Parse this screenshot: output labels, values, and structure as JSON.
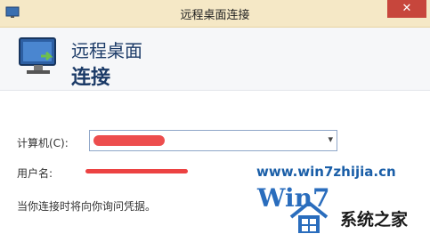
{
  "window": {
    "title": "远程桌面连接",
    "close_label": "✕"
  },
  "header": {
    "line1": "远程桌面",
    "line2": "连接"
  },
  "form": {
    "computer_label": "计算机(C):",
    "computer_value": "",
    "user_label": "用户名:",
    "user_value": "",
    "note": "当你连接时将向你询问凭据。"
  },
  "watermark": {
    "url": "www.win7zhijia.cn",
    "brand": "Win7",
    "site_name": "系统之家"
  },
  "colors": {
    "titlebar": "#f5e8c6",
    "close": "#c7463c",
    "heading": "#1b3a67",
    "redaction": "#ea2e2e"
  }
}
